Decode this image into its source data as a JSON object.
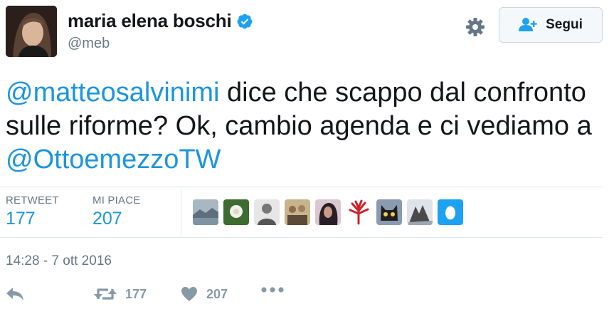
{
  "user": {
    "display_name": "maria elena boschi",
    "handle": "@meb",
    "verified": true,
    "verified_icon": "verified-badge-icon"
  },
  "header": {
    "settings_icon": "gear-icon",
    "follow_label": "Segui",
    "follow_icon": "add-user-icon"
  },
  "tweet": {
    "mention_1": "@matteosalvinimi",
    "text_1": " dice che scappo dal confronto sulle riforme? Ok, cambio agenda e ci vediamo a ",
    "mention_2": "@OttoemezzoTW"
  },
  "stats": {
    "retweets_label": "RETWEET",
    "retweets_value": "177",
    "likes_label": "MI PIACE",
    "likes_value": "207"
  },
  "likers": [
    {
      "icon": "landscape-avatar"
    },
    {
      "icon": "flower-avatar"
    },
    {
      "icon": "man-avatar"
    },
    {
      "icon": "group-avatar"
    },
    {
      "icon": "woman-avatar"
    },
    {
      "icon": "red-plant-avatar"
    },
    {
      "icon": "cat-avatar"
    },
    {
      "icon": "rock-avatar"
    },
    {
      "icon": "egg-avatar"
    }
  ],
  "timestamp": "14:28 - 7 ott 2016",
  "actions": {
    "reply_icon": "reply-icon",
    "retweet_icon": "retweet-icon",
    "retweet_count": "177",
    "like_icon": "heart-icon",
    "like_count": "207",
    "more_icon": "more-icon"
  },
  "colors": {
    "link": "#1b95e0",
    "muted": "#657786",
    "action_gray": "#8899a6",
    "border": "#e1e8ed"
  }
}
